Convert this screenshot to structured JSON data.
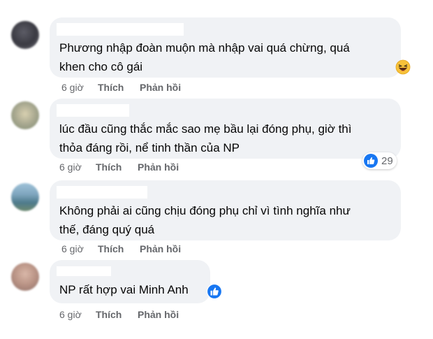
{
  "colors": {
    "bubble_bg": "#f0f2f5",
    "meta_text": "#65676b",
    "like_blue": "#1877f2",
    "emoji_yellow": "#f7c23a"
  },
  "comments": [
    {
      "text": "Phương nhập đoàn muộn mà nhập vai quá chừng, quá\nkhen cho cô gái",
      "time": "6 giờ",
      "like_label": "Thích",
      "reply_label": "Phản hồi",
      "reaction_icon": "laughing-emoji-icon"
    },
    {
      "text": "lúc đầu cũng thắc mắc sao mẹ bầu lại đóng phụ, giờ thì\nthỏa đáng rồi, nể tinh thần của NP",
      "time": "6 giờ",
      "like_label": "Thích",
      "reply_label": "Phản hồi",
      "reaction_icon": "like-icon",
      "reaction_count": "29"
    },
    {
      "text": "Không phải ai cũng chịu đóng phụ chỉ vì tình nghĩa như\nthế, đáng quý quá",
      "time": "6 giờ",
      "like_label": "Thích",
      "reply_label": "Phản hồi"
    },
    {
      "text": "NP rất hợp vai Minh Anh",
      "time": "6 giờ",
      "like_label": "Thích",
      "reply_label": "Phản hồi",
      "reaction_icon": "like-icon"
    }
  ]
}
